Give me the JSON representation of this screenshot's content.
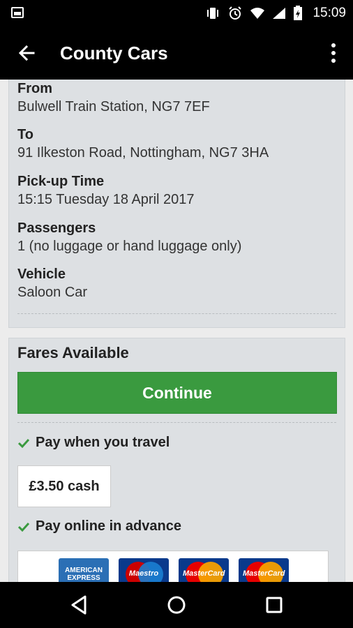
{
  "status_bar": {
    "time": "15:09",
    "icons": [
      "gallery-icon",
      "vibrate-icon",
      "alarm-icon",
      "wifi-icon",
      "signal-icon",
      "battery-icon"
    ]
  },
  "app_bar": {
    "title": "County Cars",
    "back_icon": "arrow-left-icon",
    "menu_icon": "overflow-menu-icon"
  },
  "details": {
    "from_label": "From",
    "from_value": "Bulwell Train Station, NG7 7EF",
    "to_label": "To",
    "to_value": "91 Ilkeston Road, Nottingham, NG7 3HA",
    "pickup_label": "Pick-up Time",
    "pickup_value": "15:15 Tuesday 18 April 2017",
    "passengers_label": "Passengers",
    "passengers_value": "1 (no luggage or hand luggage only)",
    "vehicle_label": "Vehicle",
    "vehicle_value": "Saloon Car"
  },
  "fares": {
    "title": "Fares Available",
    "continue_label": "Continue",
    "pay_travel_label": "Pay when you travel",
    "cash_price": "£3.50 cash",
    "pay_online_label": "Pay online in advance",
    "card_logos": [
      "AMERICAN EXPRESS",
      "Maestro",
      "MasterCard",
      "MasterCard"
    ]
  },
  "colors": {
    "accent_green": "#3a9a3f",
    "bar_black": "#000000",
    "card_bg": "#dde0e3"
  },
  "nav_bar": {
    "icons": [
      "back-triangle-icon",
      "home-circle-icon",
      "recents-square-icon"
    ]
  }
}
